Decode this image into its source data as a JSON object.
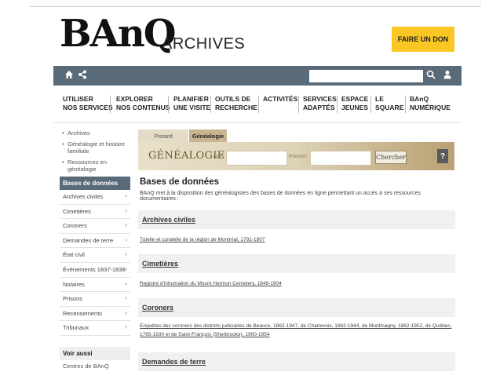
{
  "header": {
    "logo_text": "BAnQ",
    "logo_sub": "ARCHIVES",
    "donate_label": "FAIRE UN DON"
  },
  "topbar": {
    "search_value": "",
    "icons": [
      "home-icon",
      "share-icon",
      "search-icon",
      "user-icon"
    ]
  },
  "nav": {
    "items": [
      "UTILISER\nNOS SERVICES",
      "EXPLORER\nNOS CONTENUS",
      "PLANIFIER\nUNE VISITE",
      "OUTILS DE\nRECHERCHE",
      "ACTIVITÉS",
      "SERVICES\nADAPTÉS",
      "ESPACE\nJEUNES",
      "LE\nSQUARE",
      "BAnQ\nNUMÉRIQUE"
    ]
  },
  "sidebar": {
    "bullets": [
      "Archives",
      "Généalogie et histoire familiale",
      "Ressources en généalogie"
    ],
    "active": "Bases de données",
    "items": [
      "Archives civiles",
      "Cimetières",
      "Coroners",
      "Demandes de terre",
      "État civil",
      "Événements 1837-1838",
      "Notaires",
      "Prisons",
      "Recensements",
      "Tribunaux"
    ],
    "voir_aussi": "Voir aussi",
    "centres": "Centres de BAnQ"
  },
  "tabs": {
    "tab1": "Pistard",
    "tab2": "Généalogie"
  },
  "search_banner": {
    "title": "GÉNÉALOGIE",
    "nom_label": "Nom",
    "prenom_label": "Prénom",
    "nom_value": "",
    "prenom_value": "",
    "button": "Chercher",
    "help": "?"
  },
  "main": {
    "title": "Bases de données",
    "intro": "BAnQ met à la disposition des généalogistes des bases de données en ligne permettant un accès à ses ressources documentaires :",
    "sections": [
      {
        "title": "Archives civiles",
        "links": [
          "Tutelle et curatelle de la région de Montréal, 1791-1807"
        ]
      },
      {
        "title": "Cimetières",
        "links": [
          "Registre d'inhumation du Mount Hermon Cemetery, 1848-1904"
        ]
      },
      {
        "title": "Coroners",
        "links": [
          "Enquêtes des coroners des districts judiciaires de Beauce, 1862-1947, de Charlevoix, 1862-1944, de Montmagny, 1862-1952, de Québec, 1765-1930 et de Saint-François (Sherbrooke), 1900-1954"
        ]
      },
      {
        "title": "Demandes de terre",
        "links": []
      }
    ]
  },
  "colors": {
    "topbar": "#596a79",
    "donate": "#f9c623",
    "banner": "#d9ceb2"
  }
}
